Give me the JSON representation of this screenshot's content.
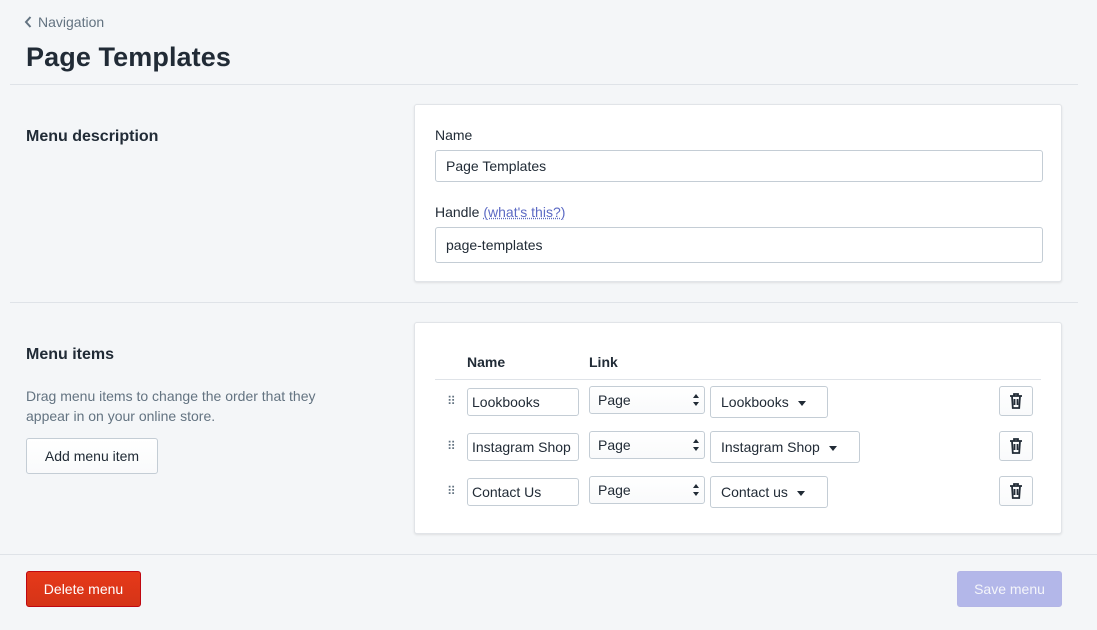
{
  "breadcrumb": {
    "label": "Navigation"
  },
  "page_title": "Page Templates",
  "menu_description": {
    "heading": "Menu description",
    "name_label": "Name",
    "name_value": "Page Templates",
    "handle_label": "Handle",
    "handle_help_link": "(what's this?)",
    "handle_value": "page-templates"
  },
  "menu_items": {
    "heading": "Menu items",
    "description": "Drag menu items to change the order that they appear in on your online store.",
    "add_button": "Add menu item",
    "columns": {
      "name": "Name",
      "link": "Link"
    },
    "rows": [
      {
        "name": "Lookbooks",
        "type": "Page",
        "link": "Lookbooks"
      },
      {
        "name": "Instagram Shop",
        "type": "Page",
        "link": "Instagram Shop"
      },
      {
        "name": "Contact Us",
        "type": "Page",
        "link": "Contact us"
      }
    ]
  },
  "footer": {
    "delete_button": "Delete menu",
    "save_button": "Save menu"
  },
  "colors": {
    "danger": "#de3618",
    "primary_disabled": "#b3b7e9",
    "link": "#5c6ac4"
  }
}
